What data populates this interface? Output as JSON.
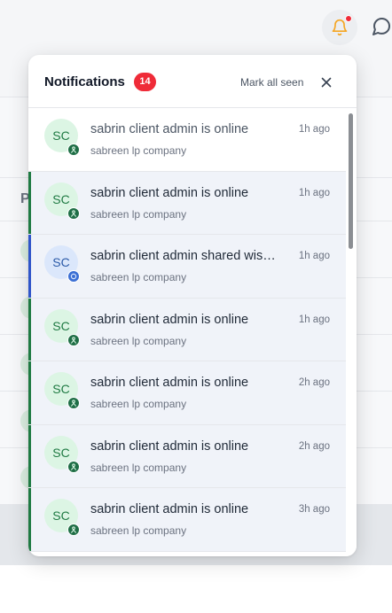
{
  "header": {
    "bell_icon": "bell-icon",
    "chat_icon": "chat-bubble-icon",
    "accent": "#f5a623",
    "alert_dot_color": "#ef2b38"
  },
  "background": {
    "column_initial": "P"
  },
  "panel": {
    "title": "Notifications",
    "count": "14",
    "mark_all_label": "Mark all seen",
    "close_icon": "close-icon"
  },
  "notifications": [
    {
      "initials": "SC",
      "title": "sabrin client admin is online",
      "company": "sabreen lp company",
      "time": "1h ago",
      "kind": "online",
      "unread": false
    },
    {
      "initials": "SC",
      "title": "sabrin client admin is online",
      "company": "sabreen lp company",
      "time": "1h ago",
      "kind": "online",
      "unread": true
    },
    {
      "initials": "SC",
      "title": "sabrin client admin shared wis…",
      "company": "sabreen lp company",
      "time": "1h ago",
      "kind": "shared",
      "unread": true
    },
    {
      "initials": "SC",
      "title": "sabrin client admin is online",
      "company": "sabreen lp company",
      "time": "1h ago",
      "kind": "online",
      "unread": true
    },
    {
      "initials": "SC",
      "title": "sabrin client admin is online",
      "company": "sabreen lp company",
      "time": "2h ago",
      "kind": "online",
      "unread": true
    },
    {
      "initials": "SC",
      "title": "sabrin client admin is online",
      "company": "sabreen lp company",
      "time": "2h ago",
      "kind": "online",
      "unread": true
    },
    {
      "initials": "SC",
      "title": "sabrin client admin is online",
      "company": "sabreen lp company",
      "time": "3h ago",
      "kind": "online",
      "unread": true
    }
  ],
  "colors": {
    "online_stripe": "#1f7a43",
    "shared_stripe": "#2f55c9",
    "unread_bg": "#f0f3f9",
    "badge": "#ef2b38"
  }
}
